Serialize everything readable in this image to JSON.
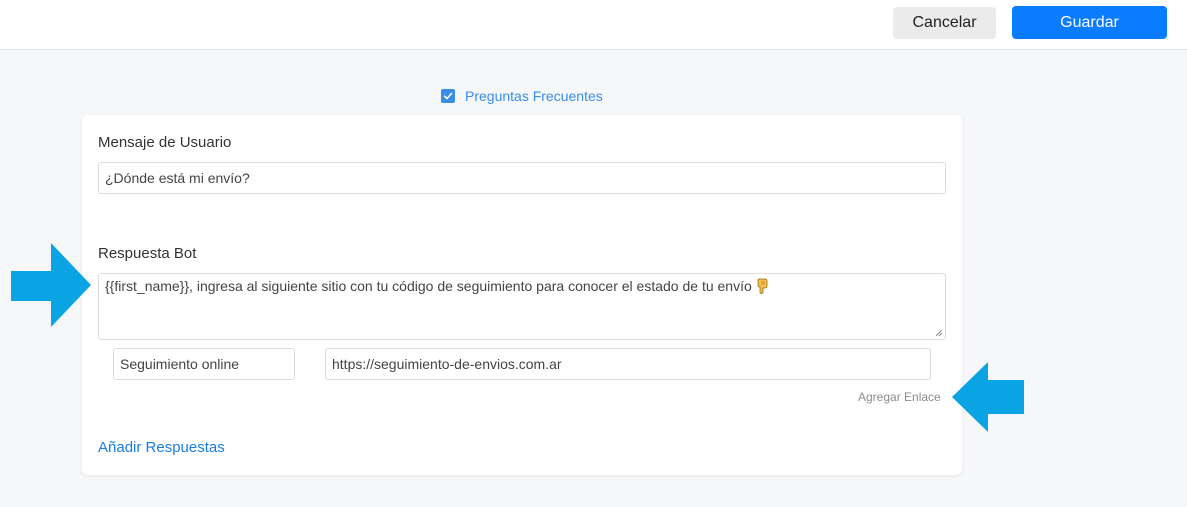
{
  "toolbar": {
    "cancel_label": "Cancelar",
    "save_label": "Guardar"
  },
  "faq": {
    "label": "Preguntas Frecuentes",
    "checked": true
  },
  "card": {
    "user_message_label": "Mensaje de Usuario",
    "user_message_value": "¿Dónde está mi envío?",
    "bot_response_label": "Respuesta Bot",
    "bot_response_value": "{{first_name}}, ingresa al siguiente sitio con tu código de seguimiento para conocer el estado de tu envío",
    "bot_response_emoji": "pointing-down-hand-icon",
    "link_text_value": "Seguimiento online",
    "link_url_value": "https://seguimiento-de-envios.com.ar",
    "add_link_label": "Agregar Enlace",
    "add_answers_label": "Añadir Respuestas"
  },
  "colors": {
    "primary": "#0a7cff",
    "link": "#1a7ee0",
    "annotation_arrow": "#0aa3e3",
    "checkbox": "#3a8ee6"
  }
}
